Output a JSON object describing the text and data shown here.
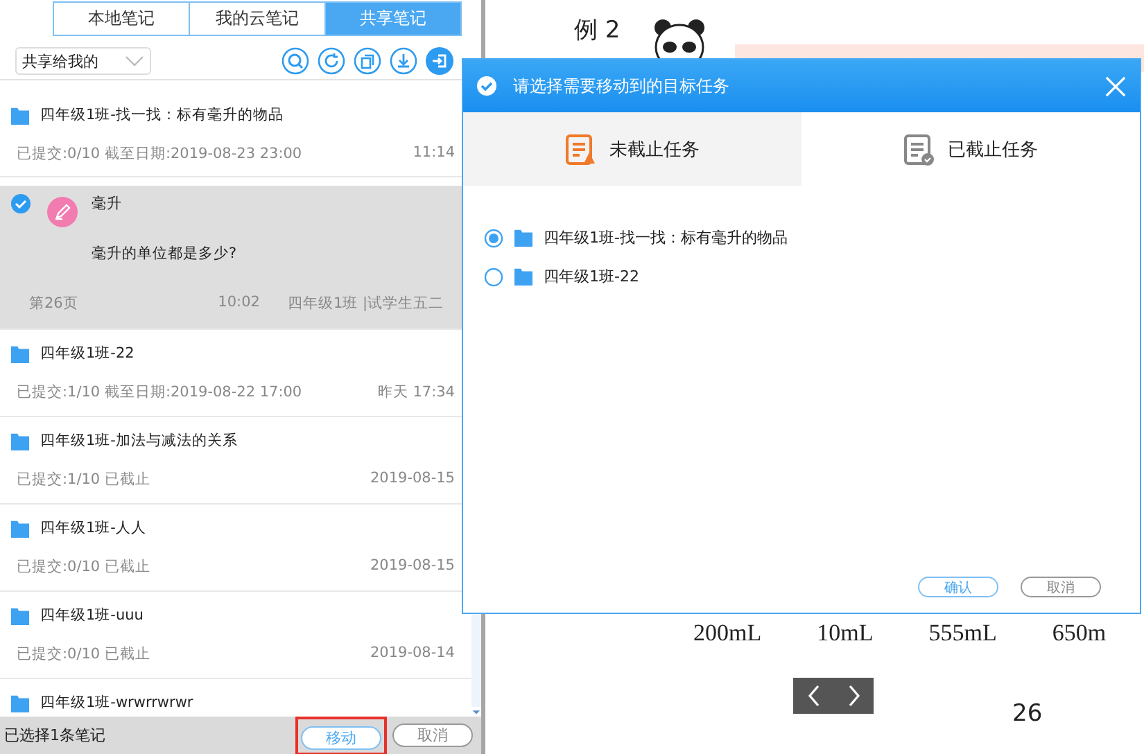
{
  "tabs": [
    {
      "label": "本地笔记",
      "selected": false
    },
    {
      "label": "我的云笔记",
      "selected": false
    },
    {
      "label": "共享笔记",
      "selected": true
    }
  ],
  "filter": {
    "value": "共享给我的"
  },
  "notes": [
    {
      "kind": "task",
      "title": "四年级1班-找一找：标有毫升的物品",
      "info": "已提交:0/10 截至日期:2019-08-23 23:00",
      "time": "11:14",
      "selected": false
    },
    {
      "kind": "note",
      "title": "毫升",
      "body": "毫升的单位都是多少?",
      "page": "第26页",
      "time": "10:02",
      "author": "四年级1班 |试学生五二",
      "selected": true
    },
    {
      "kind": "task",
      "title": "四年级1班-22",
      "info": "已提交:1/10 截至日期:2019-08-22 17:00",
      "time": "昨天 17:34",
      "selected": false
    },
    {
      "kind": "task",
      "title": "四年级1班-加法与减法的关系",
      "info": "已提交:1/10 已截止",
      "time": "2019-08-15",
      "selected": false
    },
    {
      "kind": "task",
      "title": "四年级1班-人人",
      "info": "已提交:0/10 已截止",
      "time": "2019-08-15",
      "selected": false
    },
    {
      "kind": "task",
      "title": "四年级1班-uuu",
      "info": "已提交:0/10 已截止",
      "time": "2019-08-14",
      "selected": false
    },
    {
      "kind": "task",
      "title": "四年级1班-wrwrrwrwr",
      "selected": false
    }
  ],
  "footer": {
    "status": "已选择1条笔记",
    "move": "移动",
    "cancel": "取消"
  },
  "page": {
    "heading": "例 2",
    "amounts": [
      "200mL",
      "10mL",
      "555mL",
      "650m"
    ],
    "page_number": "26"
  },
  "dialog": {
    "title": "请选择需要移动到的目标任务",
    "tabs": [
      {
        "label": "未截止任务",
        "selected": true
      },
      {
        "label": "已截止任务",
        "selected": false
      }
    ],
    "options": [
      {
        "label": "四年级1班-找一找：标有毫升的物品",
        "selected": true
      },
      {
        "label": "四年级1班-22",
        "selected": false
      }
    ],
    "confirm": "确认",
    "cancel": "取消"
  }
}
